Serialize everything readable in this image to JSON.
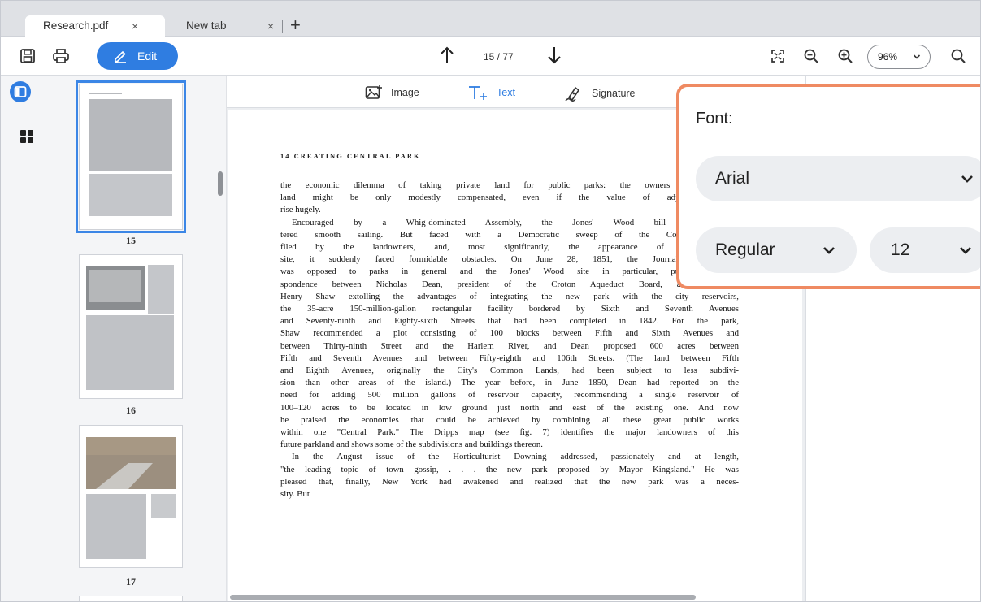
{
  "tabs": [
    {
      "label": "Research.pdf",
      "close": "×"
    },
    {
      "label": "New tab",
      "close": "×"
    }
  ],
  "new_tab_glyph": "+",
  "toolbar": {
    "edit_label": "Edit",
    "page_indicator": "15 / 77",
    "zoom_value": "96%"
  },
  "insert_bar": {
    "image_label": "Image",
    "text_label": "Text",
    "signature_label": "Signature"
  },
  "thumbnails": [
    {
      "number": "15"
    },
    {
      "number": "16"
    },
    {
      "number": "17"
    }
  ],
  "document": {
    "running_head": "14 CREATING CENTRAL PARK",
    "lines": [
      "the economic dilemma of taking private land for public parks: the owners of the ap",
      "land might be only modestly compensated, even if the value of adjacent propert",
      "rise hugely.",
      "Encouraged by a Whig-dominated Assembly, the Jones' Wood bill had initial",
      "tered smooth sailing. But faced with a Democratic sweep of the Common Counc",
      "filed by the landowners, and, most significantly, the appearance of an attractiv",
      "site, it suddenly faced formidable obstacles. On June 28, 1851, the Journal of Comm",
      "was opposed to parks in general and the Jones' Wood site in particular, published corre-",
      "spondence between Nicholas Dean, president of the Croton Aqueduct Board, and Alderman",
      "Henry Shaw extolling the advantages of integrating the new park with the city reservoirs,",
      "the 35-acre 150-million-gallon rectangular facility bordered by Sixth and Seventh Avenues",
      "and Seventy-ninth and Eighty-sixth Streets that had been completed in 1842. For the park,",
      "Shaw recommended a plot consisting of 100 blocks between Fifth and Sixth Avenues and",
      "between Thirty-ninth Street and the Harlem River, and Dean proposed 600 acres between",
      "Fifth and Seventh Avenues and between Fifty-eighth and 106th Streets. (The land between Fifth",
      "and Eighth Avenues, originally the City's Common Lands, had been subject to less subdivi-",
      "sion than other areas of the island.) The year before, in June 1850, Dean had reported on the",
      "need for adding 500 million gallons of reservoir capacity, recommending a single reservoir of",
      "100–120 acres to be located in low ground just north and east of the existing one. And now",
      "he praised the economies that could be achieved by combining all these great public works",
      "within one \"Central Park.\" The Dripps map (see fig. 7) identifies the major landowners of this",
      "future parkland and shows some of the subdivisions and buildings thereon.",
      "In the August issue of the Horticulturist Downing addressed, passionately and at length,",
      "\"the leading topic of town gossip, . . . the new park proposed by Mayor Kingsland.\" He was",
      "pleased that, finally, New York had awakened and realized that the new park was a neces-",
      "sity. But"
    ]
  },
  "font_popup": {
    "label": "Font:",
    "family": "Arial",
    "style": "Regular",
    "size": "12"
  },
  "colors": {
    "accent": "#2f7de1",
    "popup_border": "#ef8a62"
  }
}
